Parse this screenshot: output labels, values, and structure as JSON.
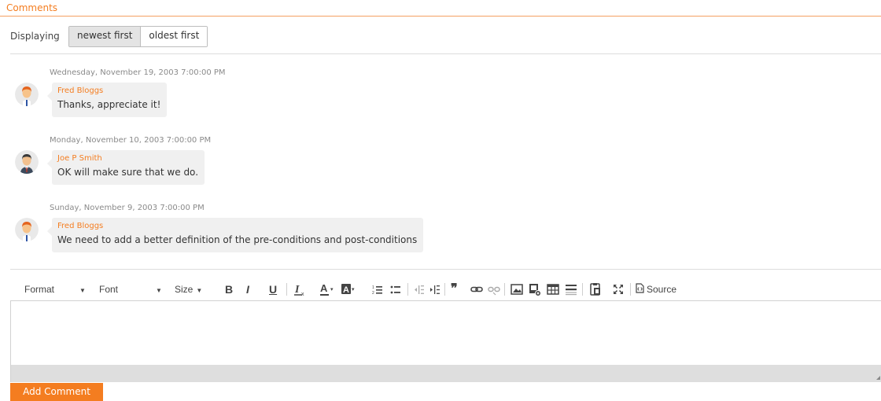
{
  "section": {
    "title": "Comments"
  },
  "sort": {
    "label": "Displaying",
    "options": [
      {
        "label": "newest first",
        "active": true
      },
      {
        "label": "oldest first",
        "active": false
      }
    ]
  },
  "comments": [
    {
      "date": "Wednesday, November 19, 2003 7:00:00 PM",
      "author": "Fred Bloggs",
      "text": "Thanks, appreciate it!",
      "avatar": "red-hair-man-avatar"
    },
    {
      "date": "Monday, November 10, 2003 7:00:00 PM",
      "author": "Joe P Smith",
      "text": "OK will make sure that we do.",
      "avatar": "dark-hair-man-avatar"
    },
    {
      "date": "Sunday, November 9, 2003 7:00:00 PM",
      "author": "Fred Bloggs",
      "text": "We need to add a better definition of the pre-conditions and post-conditions",
      "avatar": "red-hair-man-avatar"
    }
  ],
  "toolbar": {
    "format": "Format",
    "font": "Font",
    "size": "Size",
    "bold": "B",
    "italic": "I",
    "underline": "U",
    "blockquote": "❞",
    "source": "Source"
  },
  "editor": {
    "value": ""
  },
  "actions": {
    "add_comment": "Add Comment"
  },
  "colors": {
    "accent": "#f47d20",
    "bubble": "#f0f0f0",
    "date": "#8a8a8a"
  }
}
